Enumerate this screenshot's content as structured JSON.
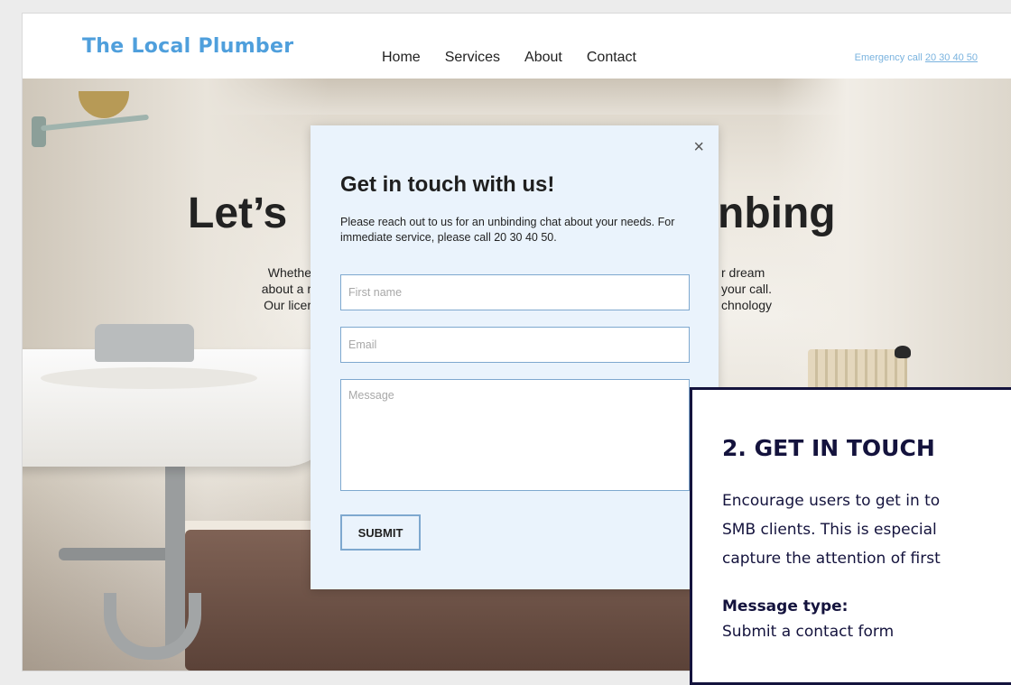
{
  "header": {
    "logo": "The Local Plumber",
    "nav": [
      "Home",
      "Services",
      "About",
      "Contact"
    ],
    "emergency_label": "Emergency call ",
    "emergency_number": "20 30 40 50"
  },
  "hero": {
    "title_left": "Let’s",
    "title_right": "nbing",
    "text_left": [
      "Whethe",
      "about a r",
      "Our licer"
    ],
    "text_right": [
      "r dream",
      "your call.",
      "chnology"
    ]
  },
  "modal": {
    "close": "×",
    "title": "Get in touch with us!",
    "description": "Please reach out to us for an unbinding chat about your needs. For immediate service, please call 20 30 40 50.",
    "first_name_placeholder": "First name",
    "email_placeholder": "Email",
    "message_placeholder": "Message",
    "submit": "SUBMIT"
  },
  "annotation": {
    "title": "2. GET IN TOUCH",
    "body": [
      "Encourage users to get in to",
      "SMB clients. This is especial",
      "capture the attention of first"
    ],
    "label": "Message type:",
    "value": "Submit a contact form"
  },
  "colors": {
    "logo": "#4f9fdc",
    "modal_bg": "#eaf3fc",
    "field_border": "#7ea8cf",
    "annotation_border": "#14133d"
  }
}
